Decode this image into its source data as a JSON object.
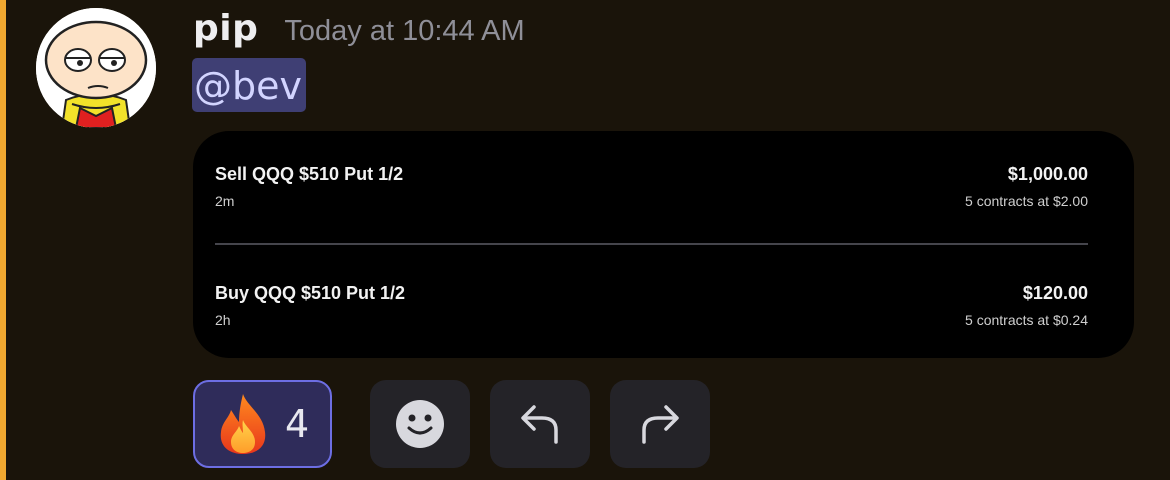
{
  "message": {
    "username": "pip",
    "timestamp": "Today at 10:44 AM",
    "mention": "@bev"
  },
  "trades": [
    {
      "title": "Sell QQQ $510 Put 1/2",
      "age": "2m",
      "amount": "$1,000.00",
      "detail": "5 contracts at $2.00"
    },
    {
      "title": "Buy QQQ $510 Put 1/2",
      "age": "2h",
      "amount": "$120.00",
      "detail": "5 contracts at $0.24"
    }
  ],
  "reactions": {
    "fire": {
      "icon": "fire-emoji-icon",
      "count": "4"
    },
    "add_reaction_icon": "smiley-face-icon",
    "reply_icon": "reply-arrow-icon",
    "forward_icon": "forward-arrow-icon"
  },
  "colors": {
    "background": "#1a140a",
    "accent_bar": "#f0a830",
    "mention_bg": "#3f3f74",
    "reaction_active_bg": "#2f2c5a",
    "reaction_active_border": "#6d6ee3"
  }
}
